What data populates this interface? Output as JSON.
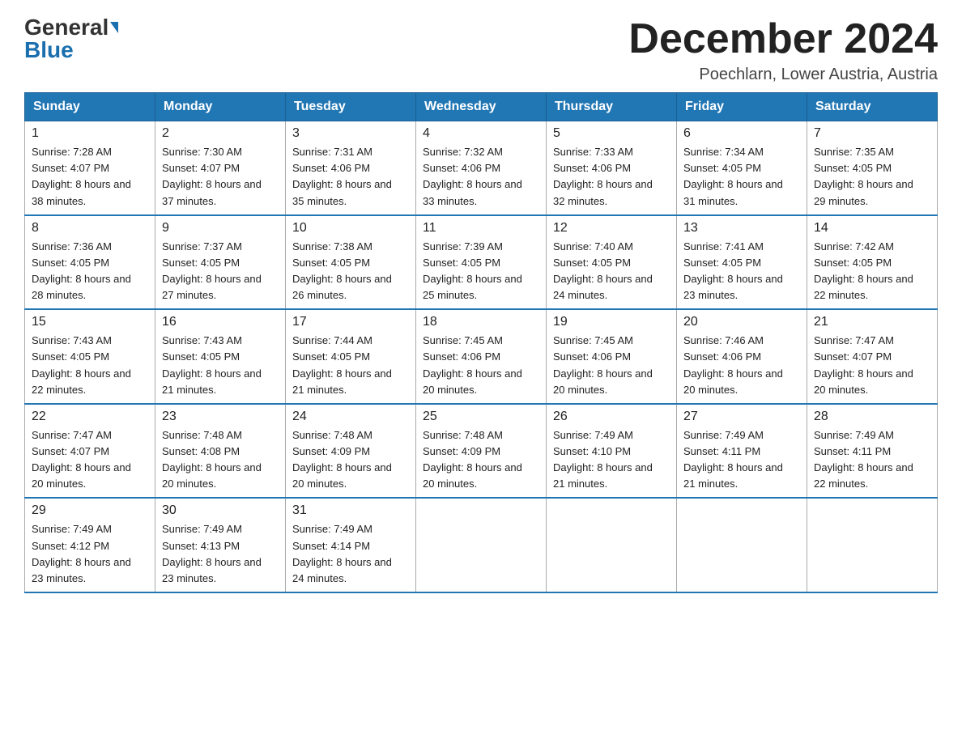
{
  "logo": {
    "general": "General",
    "blue": "Blue"
  },
  "title": "December 2024",
  "location": "Poechlarn, Lower Austria, Austria",
  "weekdays": [
    "Sunday",
    "Monday",
    "Tuesday",
    "Wednesday",
    "Thursday",
    "Friday",
    "Saturday"
  ],
  "weeks": [
    [
      {
        "day": "1",
        "sunrise": "7:28 AM",
        "sunset": "4:07 PM",
        "daylight": "8 hours and 38 minutes."
      },
      {
        "day": "2",
        "sunrise": "7:30 AM",
        "sunset": "4:07 PM",
        "daylight": "8 hours and 37 minutes."
      },
      {
        "day": "3",
        "sunrise": "7:31 AM",
        "sunset": "4:06 PM",
        "daylight": "8 hours and 35 minutes."
      },
      {
        "day": "4",
        "sunrise": "7:32 AM",
        "sunset": "4:06 PM",
        "daylight": "8 hours and 33 minutes."
      },
      {
        "day": "5",
        "sunrise": "7:33 AM",
        "sunset": "4:06 PM",
        "daylight": "8 hours and 32 minutes."
      },
      {
        "day": "6",
        "sunrise": "7:34 AM",
        "sunset": "4:05 PM",
        "daylight": "8 hours and 31 minutes."
      },
      {
        "day": "7",
        "sunrise": "7:35 AM",
        "sunset": "4:05 PM",
        "daylight": "8 hours and 29 minutes."
      }
    ],
    [
      {
        "day": "8",
        "sunrise": "7:36 AM",
        "sunset": "4:05 PM",
        "daylight": "8 hours and 28 minutes."
      },
      {
        "day": "9",
        "sunrise": "7:37 AM",
        "sunset": "4:05 PM",
        "daylight": "8 hours and 27 minutes."
      },
      {
        "day": "10",
        "sunrise": "7:38 AM",
        "sunset": "4:05 PM",
        "daylight": "8 hours and 26 minutes."
      },
      {
        "day": "11",
        "sunrise": "7:39 AM",
        "sunset": "4:05 PM",
        "daylight": "8 hours and 25 minutes."
      },
      {
        "day": "12",
        "sunrise": "7:40 AM",
        "sunset": "4:05 PM",
        "daylight": "8 hours and 24 minutes."
      },
      {
        "day": "13",
        "sunrise": "7:41 AM",
        "sunset": "4:05 PM",
        "daylight": "8 hours and 23 minutes."
      },
      {
        "day": "14",
        "sunrise": "7:42 AM",
        "sunset": "4:05 PM",
        "daylight": "8 hours and 22 minutes."
      }
    ],
    [
      {
        "day": "15",
        "sunrise": "7:43 AM",
        "sunset": "4:05 PM",
        "daylight": "8 hours and 22 minutes."
      },
      {
        "day": "16",
        "sunrise": "7:43 AM",
        "sunset": "4:05 PM",
        "daylight": "8 hours and 21 minutes."
      },
      {
        "day": "17",
        "sunrise": "7:44 AM",
        "sunset": "4:05 PM",
        "daylight": "8 hours and 21 minutes."
      },
      {
        "day": "18",
        "sunrise": "7:45 AM",
        "sunset": "4:06 PM",
        "daylight": "8 hours and 20 minutes."
      },
      {
        "day": "19",
        "sunrise": "7:45 AM",
        "sunset": "4:06 PM",
        "daylight": "8 hours and 20 minutes."
      },
      {
        "day": "20",
        "sunrise": "7:46 AM",
        "sunset": "4:06 PM",
        "daylight": "8 hours and 20 minutes."
      },
      {
        "day": "21",
        "sunrise": "7:47 AM",
        "sunset": "4:07 PM",
        "daylight": "8 hours and 20 minutes."
      }
    ],
    [
      {
        "day": "22",
        "sunrise": "7:47 AM",
        "sunset": "4:07 PM",
        "daylight": "8 hours and 20 minutes."
      },
      {
        "day": "23",
        "sunrise": "7:48 AM",
        "sunset": "4:08 PM",
        "daylight": "8 hours and 20 minutes."
      },
      {
        "day": "24",
        "sunrise": "7:48 AM",
        "sunset": "4:09 PM",
        "daylight": "8 hours and 20 minutes."
      },
      {
        "day": "25",
        "sunrise": "7:48 AM",
        "sunset": "4:09 PM",
        "daylight": "8 hours and 20 minutes."
      },
      {
        "day": "26",
        "sunrise": "7:49 AM",
        "sunset": "4:10 PM",
        "daylight": "8 hours and 21 minutes."
      },
      {
        "day": "27",
        "sunrise": "7:49 AM",
        "sunset": "4:11 PM",
        "daylight": "8 hours and 21 minutes."
      },
      {
        "day": "28",
        "sunrise": "7:49 AM",
        "sunset": "4:11 PM",
        "daylight": "8 hours and 22 minutes."
      }
    ],
    [
      {
        "day": "29",
        "sunrise": "7:49 AM",
        "sunset": "4:12 PM",
        "daylight": "8 hours and 23 minutes."
      },
      {
        "day": "30",
        "sunrise": "7:49 AM",
        "sunset": "4:13 PM",
        "daylight": "8 hours and 23 minutes."
      },
      {
        "day": "31",
        "sunrise": "7:49 AM",
        "sunset": "4:14 PM",
        "daylight": "8 hours and 24 minutes."
      },
      null,
      null,
      null,
      null
    ]
  ]
}
